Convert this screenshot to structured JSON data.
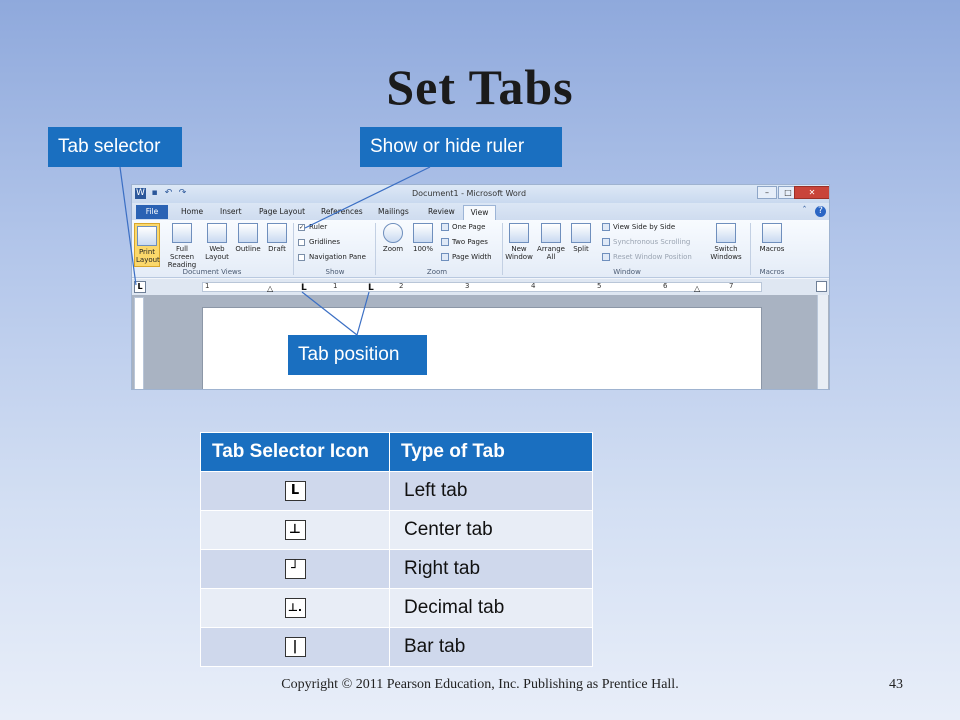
{
  "slide": {
    "title": "Set Tabs",
    "footer": "Copyright © 2011 Pearson Education, Inc. Publishing as Prentice Hall.",
    "page_number": "43"
  },
  "callouts": {
    "tab_selector": "Tab selector",
    "show_hide_ruler": "Show or hide ruler",
    "tab_position": "Tab position"
  },
  "word": {
    "window_title": "Document1 - Microsoft Word",
    "ribbon_tabs": [
      "File",
      "Home",
      "Insert",
      "Page Layout",
      "References",
      "Mailings",
      "Review",
      "View"
    ],
    "groups": {
      "document_views": {
        "label": "Document Views",
        "buttons": [
          "Print Layout",
          "Full Screen Reading",
          "Web Layout",
          "Outline",
          "Draft"
        ]
      },
      "show": {
        "label": "Show",
        "items": [
          "Ruler",
          "Gridlines",
          "Navigation Pane"
        ],
        "ruler_checked": "✓"
      },
      "zoom": {
        "label": "Zoom",
        "buttons": [
          "Zoom",
          "100%"
        ],
        "items": [
          "One Page",
          "Two Pages",
          "Page Width"
        ]
      },
      "window": {
        "label": "Window",
        "buttons": [
          "New Window",
          "Arrange All",
          "Split"
        ],
        "items": [
          "View Side by Side",
          "Synchronous Scrolling",
          "Reset Window Position"
        ],
        "switch": "Switch Windows"
      },
      "macros": {
        "label": "Macros",
        "button": "Macros"
      }
    },
    "ruler_numbers": [
      "1",
      "1",
      "2",
      "3",
      "4",
      "5",
      "6",
      "7"
    ],
    "tab_selector_glyph": "L",
    "tab_marks": [
      "L",
      "L"
    ]
  },
  "table": {
    "headers": [
      "Tab Selector Icon",
      "Type of Tab"
    ],
    "rows": [
      {
        "icon": "L",
        "type": "Left tab"
      },
      {
        "icon": "⊥",
        "type": "Center tab"
      },
      {
        "icon": "┘",
        "type": "Right tab"
      },
      {
        "icon": "⊥.",
        "type": "Decimal tab"
      },
      {
        "icon": "|",
        "type": "Bar tab"
      }
    ]
  }
}
